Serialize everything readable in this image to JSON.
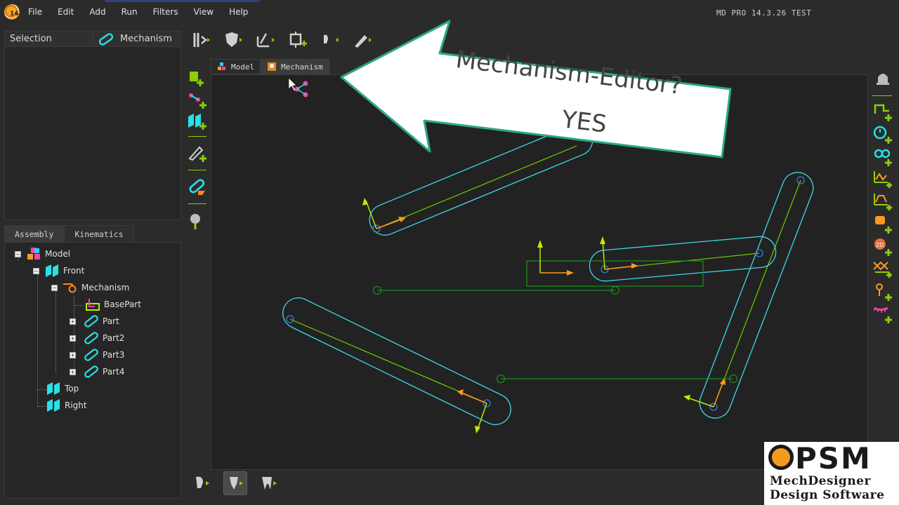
{
  "app": {
    "version_text": "MD PRO 14.3.26  TEST",
    "icon_badge": "14"
  },
  "menu": [
    "File",
    "Edit",
    "Add",
    "Run",
    "Filters",
    "View",
    "Help"
  ],
  "selection_panel": {
    "header_left": "Selection",
    "header_right": "Mechanism"
  },
  "tree_tabs": [
    "Assembly",
    "Kinematics"
  ],
  "tree": {
    "model": "Model",
    "front": "Front",
    "mechanism": "Mechanism",
    "basepart": "BasePart",
    "part": "Part",
    "part2": "Part2",
    "part3": "Part3",
    "part4": "Part4",
    "top": "Top",
    "right": "Right"
  },
  "editor_tabs": [
    "Model",
    "Mechanism"
  ],
  "callout": {
    "line1": "Mechanism-Editor?",
    "line2": "YES"
  },
  "logo": {
    "brand": "PSM",
    "line1": "MechDesigner",
    "line2": "Design Software"
  },
  "colors": {
    "part_outline": "#3fd8e8",
    "link_line": "#6fd000",
    "arrow_orange": "#ff9a1e",
    "arrow_green": "#b8f000",
    "accent_cyan": "#29e0e6",
    "callout_border": "#2aa88a"
  }
}
